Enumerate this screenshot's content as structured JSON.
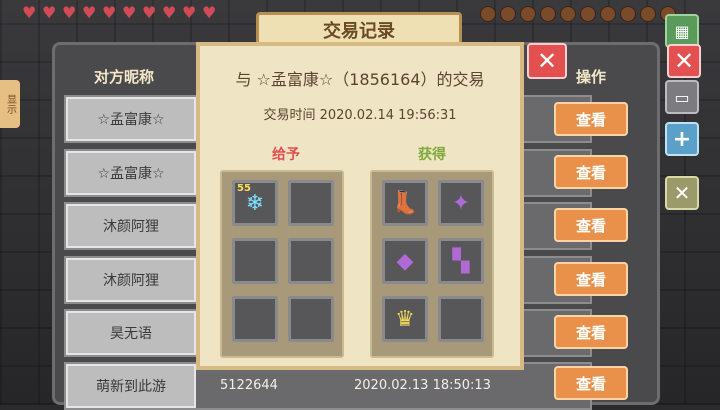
{
  "title": "交易记录",
  "columns": {
    "name": "对方昵称",
    "action": "操作"
  },
  "left_tab": "显示",
  "rows": [
    {
      "name": "☆孟富康☆",
      "uid": "",
      "time": "",
      "button": "查看"
    },
    {
      "name": "☆孟富康☆",
      "uid": "",
      "time": "",
      "button": "查看"
    },
    {
      "name": "沐颜阿狸",
      "uid": "",
      "time": "",
      "button": "查看"
    },
    {
      "name": "沐颜阿狸",
      "uid": "",
      "time": "",
      "button": "查看"
    },
    {
      "name": "昊无语",
      "uid": "",
      "time": "",
      "button": "查看"
    },
    {
      "name": "萌新到此游",
      "uid": "5122644",
      "time": "2020.02.13 18:50:13",
      "button": "查看"
    }
  ],
  "dialog": {
    "title": "与 ☆孟富康☆（1856164）的交易",
    "time": "交易时间 2020.02.14 19:56:31",
    "give_label": "给予",
    "get_label": "获得",
    "give_items": [
      {
        "icon": "crystal-icon",
        "glyph": "❄",
        "count": "55"
      },
      {
        "icon": "",
        "glyph": "",
        "count": ""
      },
      {
        "icon": "",
        "glyph": "",
        "count": ""
      },
      {
        "icon": "",
        "glyph": "",
        "count": ""
      },
      {
        "icon": "",
        "glyph": "",
        "count": ""
      },
      {
        "icon": "",
        "glyph": "",
        "count": ""
      }
    ],
    "get_items": [
      {
        "icon": "boots-icon",
        "glyph": "👢",
        "count": ""
      },
      {
        "icon": "scroll-icon",
        "glyph": "✦",
        "count": ""
      },
      {
        "icon": "chestplate-icon",
        "glyph": "◆",
        "count": ""
      },
      {
        "icon": "leggings-icon",
        "glyph": "▚",
        "count": ""
      },
      {
        "icon": "crown-icon",
        "glyph": "♛",
        "count": ""
      },
      {
        "icon": "",
        "glyph": "",
        "count": ""
      }
    ]
  },
  "close_glyph": "✕"
}
